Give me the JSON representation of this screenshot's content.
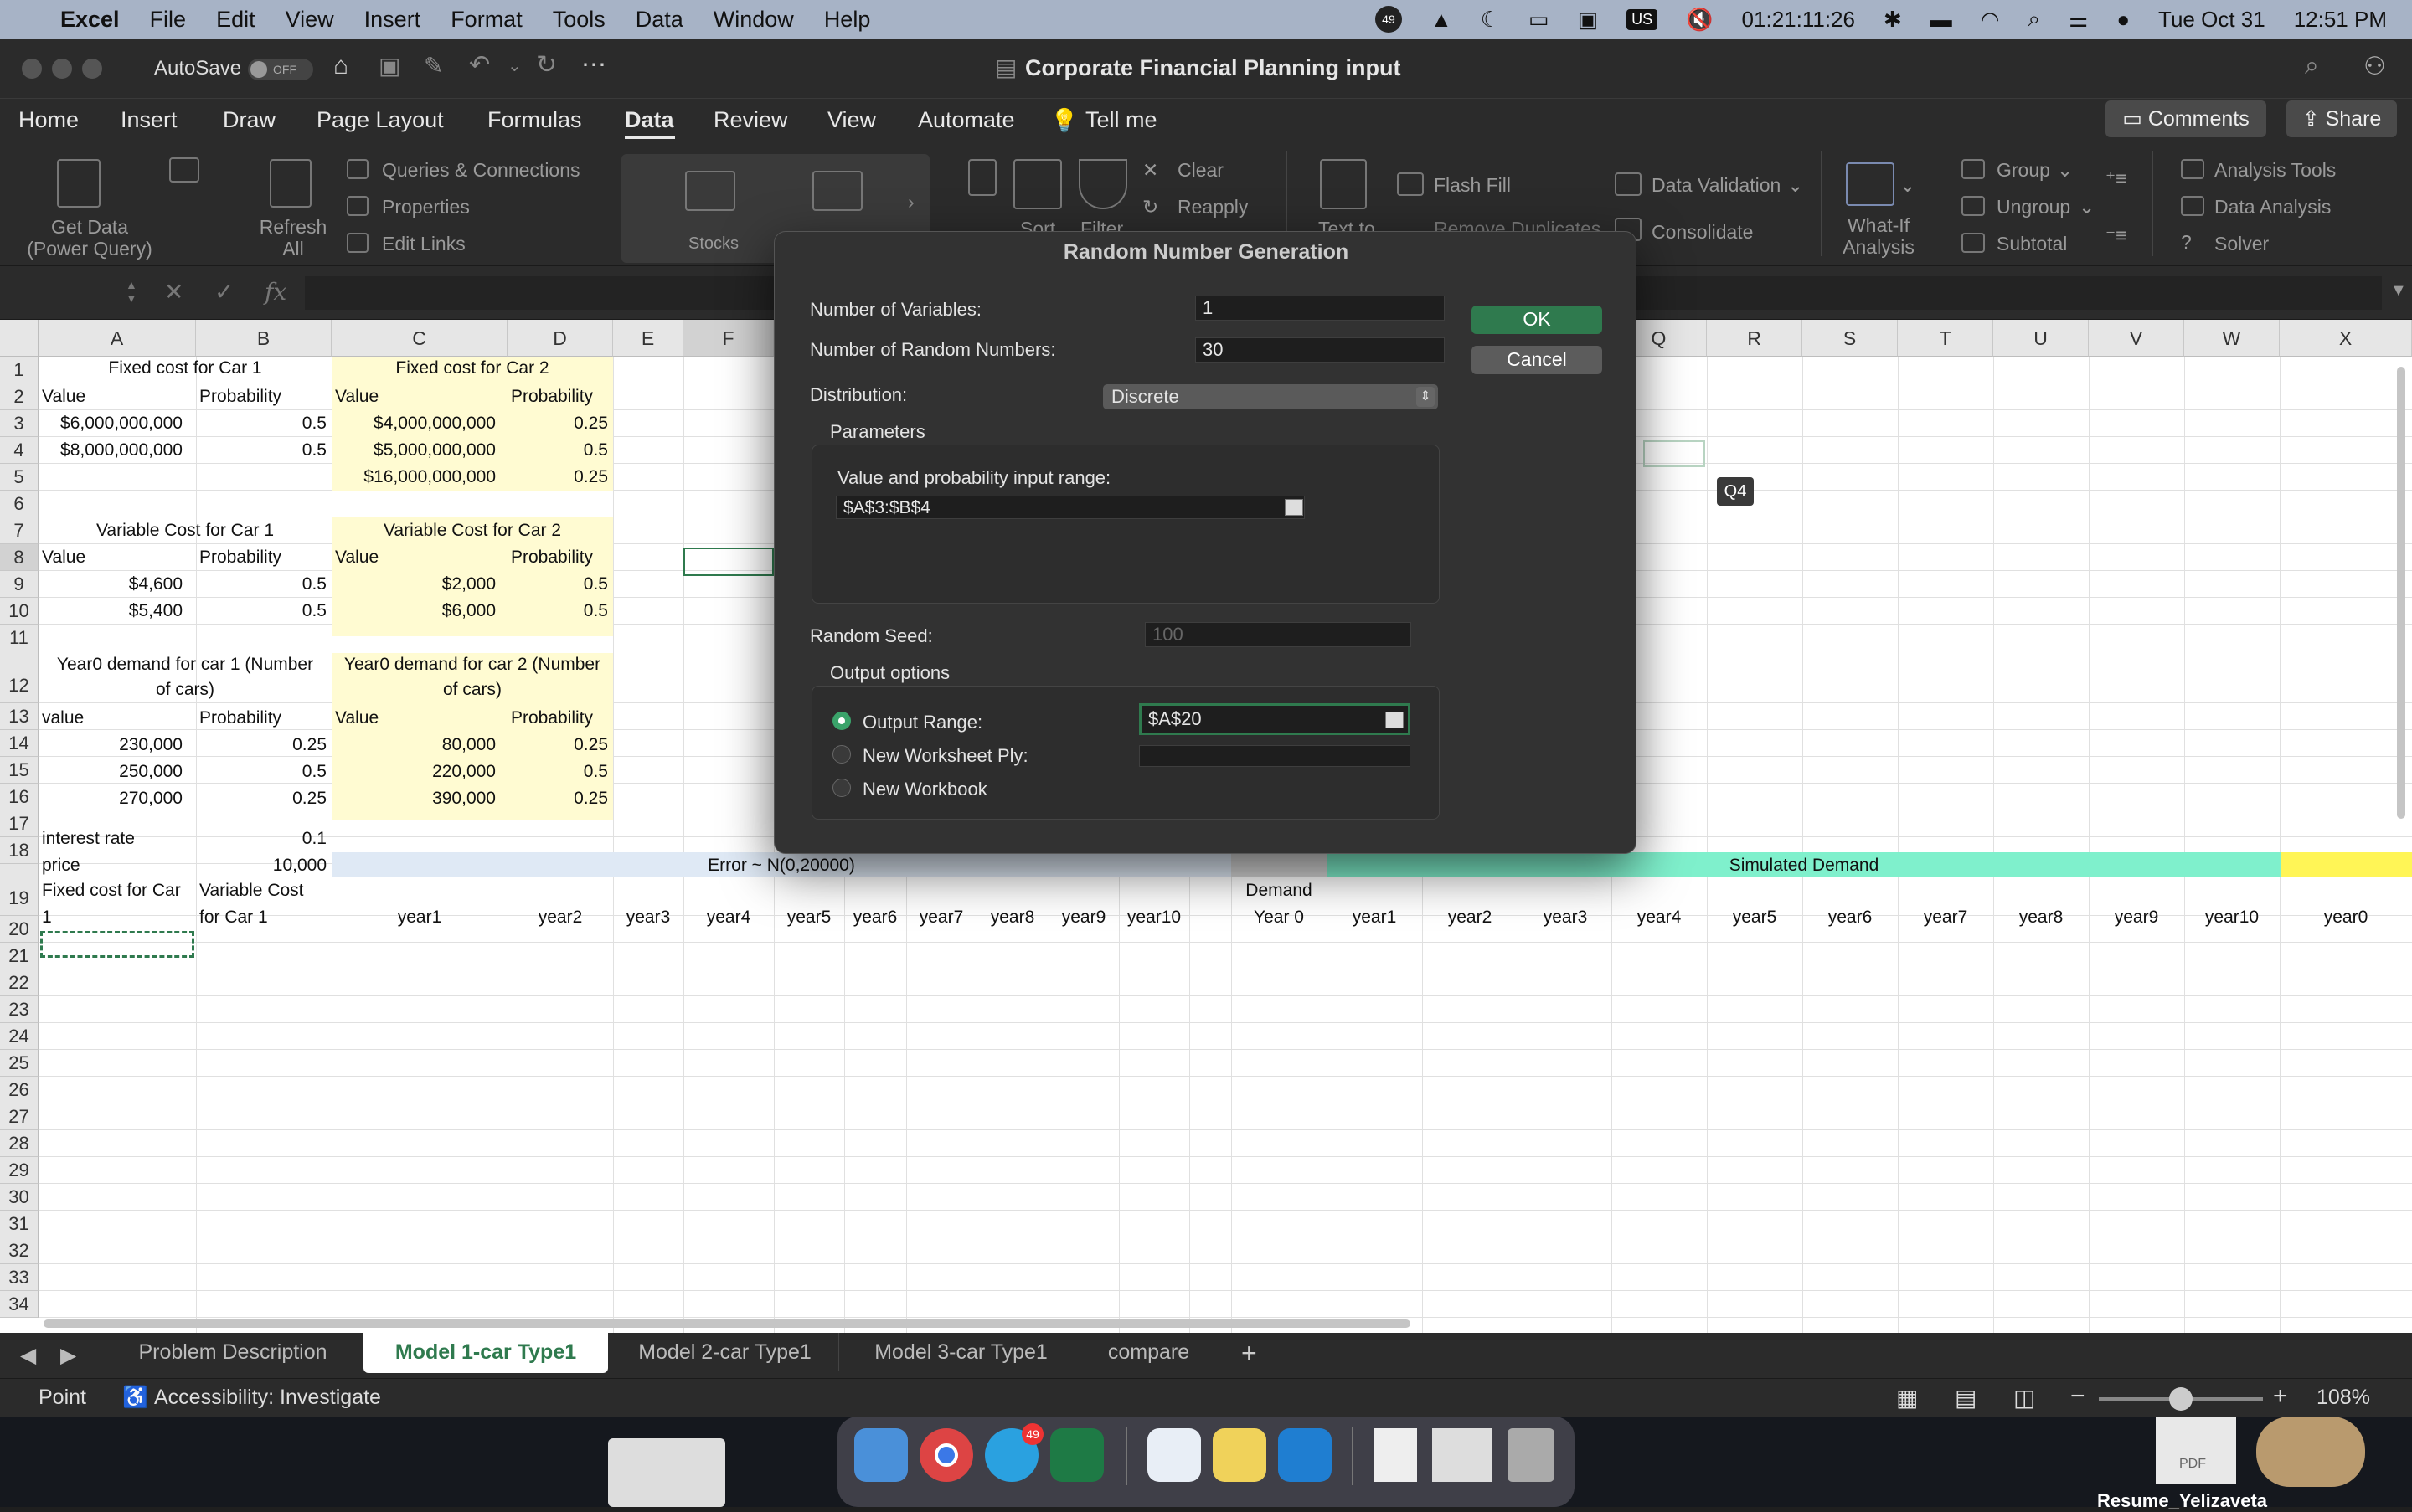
{
  "menubar": {
    "apple": "",
    "app": "Excel",
    "items": [
      "File",
      "Edit",
      "View",
      "Insert",
      "Format",
      "Tools",
      "Data",
      "Window",
      "Help"
    ],
    "timer": "01:21:11:26",
    "date": "Tue Oct 31",
    "time": "12:51 PM",
    "lang": "US",
    "badge": "49"
  },
  "titlebar": {
    "autosave": "AutoSave",
    "autosave_state": "OFF",
    "title": "Corporate Financial Planning input"
  },
  "tabs": [
    "Home",
    "Insert",
    "Draw",
    "Page Layout",
    "Formulas",
    "Data",
    "Review",
    "View",
    "Automate",
    "Tell me"
  ],
  "active_tab": "Data",
  "right_buttons": {
    "comments": "Comments",
    "share": "Share"
  },
  "ribbon": {
    "get_data": "Get Data (Power Query)",
    "refresh": "Refresh All",
    "queries": "Queries & Connections",
    "properties": "Properties",
    "edit_links": "Edit Links",
    "stocks": "Stocks",
    "currencies": "Currencies",
    "sort": "Sort",
    "filter": "Filter",
    "clear": "Clear",
    "reapply": "Reapply",
    "text_to": "Text to",
    "flash_fill": "Flash Fill",
    "remove_dup": "Remove Duplicates",
    "data_validation": "Data Validation",
    "consolidate": "Consolidate",
    "whatif": "What-If Analysis",
    "group": "Group",
    "ungroup": "Ungroup",
    "subtotal": "Subtotal",
    "analysis_tools": "Analysis Tools",
    "data_analysis": "Data Analysis",
    "solver": "Solver"
  },
  "formula": {
    "fx": "fx",
    "cell_ref": "",
    "content": ""
  },
  "columns": [
    "A",
    "B",
    "C",
    "D",
    "E",
    "F",
    "",
    "",
    "",
    "",
    "",
    "",
    "",
    "",
    "Q",
    "R",
    "S",
    "T",
    "U",
    "V",
    "W",
    "X"
  ],
  "rows": [
    "1",
    "2",
    "3",
    "4",
    "5",
    "6",
    "7",
    "8",
    "9",
    "10",
    "11",
    "12",
    "13",
    "14",
    "15",
    "16",
    "17",
    "18",
    "19",
    "20",
    "21",
    "22",
    "23",
    "24",
    "25",
    "26",
    "27",
    "28",
    "29",
    "30",
    "31",
    "32",
    "33",
    "34"
  ],
  "cells": {
    "A1": "Fixed cost for Car 1",
    "C1": "Fixed cost for Car 2",
    "A2": "Value",
    "B2": "Probability",
    "C2": "Value",
    "D2": "Probability",
    "A3": "$6,000,000,000",
    "B3": "0.5",
    "C3": "$4,000,000,000",
    "D3": "0.25",
    "A4": "$8,000,000,000",
    "B4": "0.5",
    "C4": "$5,000,000,000",
    "D4": "0.5",
    "C5": "$16,000,000,000",
    "D5": "0.25",
    "A7": "Variable Cost for Car 1",
    "C7": "Variable Cost for Car 2",
    "A8": "Value",
    "B8": "Probability",
    "C8": "Value",
    "D8": "Probability",
    "A9": "$4,600",
    "B9": "0.5",
    "C9": "$2,000",
    "D9": "0.5",
    "A10": "$5,400",
    "B10": "0.5",
    "C10": "$6,000",
    "D10": "0.5",
    "A12a": "Year0 demand for car 1 (Number",
    "A12b": "of cars)",
    "C12a": "Year0 demand for car 2 (Number",
    "C12b": "of cars)",
    "A13": "value",
    "B13": "Probability",
    "C13": "Value",
    "D13": "Probability",
    "A14": "230,000",
    "B14": "0.25",
    "C14": "80,000",
    "D14": "0.25",
    "A15": "250,000",
    "B15": "0.5",
    "C15": "220,000",
    "D15": "0.5",
    "A16": "270,000",
    "B16": "0.25",
    "C16": "390,000",
    "D16": "0.25",
    "A17": "interest rate",
    "B17": "0.1",
    "A18": "price",
    "B18": "10,000",
    "error_label": "Error ~ N(0,20000)",
    "sim_label": "Simulated Demand",
    "A19a": "Fixed cost for Car",
    "A19b": "1",
    "B19a": "Variable Cost",
    "B19b": "for Car 1",
    "demand_a": "Demand",
    "demand_b": "Year 0",
    "years_left": [
      "year1",
      "year2",
      "year3",
      "year4",
      "year5",
      "year6",
      "year7",
      "year8",
      "year9",
      "year10"
    ],
    "years_right": [
      "year1",
      "year2",
      "year3",
      "year4",
      "year5",
      "year6",
      "year7",
      "year8",
      "year9",
      "year10",
      "year0"
    ],
    "tooltip": "Q4"
  },
  "dialog": {
    "title": "Random Number Generation",
    "num_vars_label": "Number of Variables:",
    "num_vars": "1",
    "num_random_label": "Number of Random Numbers:",
    "num_random": "30",
    "distribution_label": "Distribution:",
    "distribution": "Discrete",
    "parameters_label": "Parameters",
    "range_label": "Value and probability input range:",
    "range": "$A$3:$B$4",
    "seed_label": "Random Seed:",
    "seed_placeholder": "100",
    "output_label": "Output options",
    "output_range_label": "Output Range:",
    "output_range": "$A$20",
    "new_ply_label": "New Worksheet Ply:",
    "new_workbook_label": "New Workbook",
    "ok": "OK",
    "cancel": "Cancel"
  },
  "sheet_tabs": [
    "Problem Description",
    "Model 1-car Type1",
    "Model 2-car Type1",
    "Model 3-car Type1",
    "compare"
  ],
  "active_sheet": "Model 1-car Type1",
  "status": {
    "mode": "Point",
    "accessibility": "Accessibility: Investigate",
    "zoom": "108%"
  },
  "desktop": {
    "resume": "Resume_Yelizaveta",
    "pdf": "PDF",
    "dock_badge": "49"
  }
}
